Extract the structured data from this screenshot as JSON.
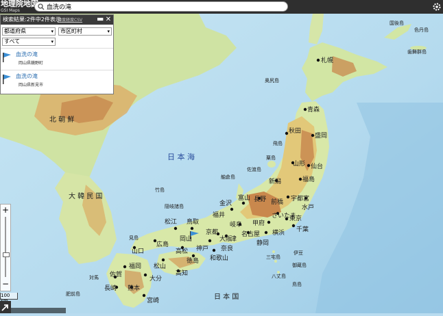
{
  "app": {
    "title": "地理院地図",
    "subtitle": "GSI Maps",
    "search_value": "血洗の滝"
  },
  "results_panel": {
    "title": "検索結果:2件中2件表示",
    "csv_link": "緯度経度CSV",
    "filter_pref": "都道府県",
    "filter_city": "市区町村",
    "filter_kind": "すべて",
    "results": [
      {
        "name": "血洗の滝",
        "address": "岡山県鏡野町"
      },
      {
        "name": "血洗の滝",
        "address": "岡山県新見市"
      }
    ]
  },
  "map": {
    "sea_labels": [
      "日 本 海",
      "日 本 国"
    ],
    "country_labels": [
      "北 朝 鮮",
      "大 韓 民 国"
    ],
    "place_labels": {
      "sapporo": "札幌",
      "okushiri": "奥尻島",
      "aomori": "青森",
      "akita": "秋田",
      "morioka": "盛岡",
      "yamagata": "山形",
      "sendai": "仙台",
      "fukushima": "福島",
      "niigata": "新潟",
      "sado": "佐渡島",
      "tobishima": "飛島",
      "awashima": "粟島",
      "utsunomiya": "宇都宮",
      "mito": "水戸",
      "maebashi": "前橋",
      "nagano": "長野",
      "toyama": "富山",
      "kanazawa": "金沢",
      "fukui": "福井",
      "gifu": "岐阜",
      "kofu": "甲府",
      "saitama": "さいたま",
      "tokyo": "東京",
      "chiba": "千葉",
      "yokohama": "横浜",
      "shizuoka": "静岡",
      "nagoya": "名古屋",
      "tsu": "津",
      "nara": "奈良",
      "osaka": "大阪",
      "kyoto": "京都",
      "kobe": "神戸",
      "wakayama": "和歌山",
      "tottori": "鳥取",
      "matsue": "松江",
      "okayama": "岡山",
      "hiroshima": "広島",
      "yamaguchi": "山口",
      "takamatsu": "高松",
      "tokushima": "徳島",
      "matsuyama": "松山",
      "kochi": "高知",
      "fukuoka": "福岡",
      "saga": "佐賀",
      "nagasaki": "長崎",
      "kumamoto": "熊本",
      "oita": "大分",
      "miyazaki": "宮崎",
      "takeshima": "竹島",
      "oki": "隠岐諸島",
      "mishima": "見島",
      "tsushima": "対馬",
      "noto_island": "舳倉島",
      "gotou": "五島",
      "hizen": "肥前島",
      "kunashiri": "国後島",
      "shikotan": "色丹島",
      "habomai": "歯舞群島",
      "miyake": "三宅島",
      "hachijo": "八丈島",
      "tori": "鳥島",
      "mikura": "御蔵島",
      "izu": "伊豆"
    }
  },
  "controls": {
    "zoom_in": "+",
    "zoom_out": "−",
    "scale": "100 km"
  },
  "colors": {
    "sea": "#b9dcf0",
    "lowland": "#cfe6a5",
    "midland": "#e8d97d",
    "highland": "#d29a5a"
  }
}
